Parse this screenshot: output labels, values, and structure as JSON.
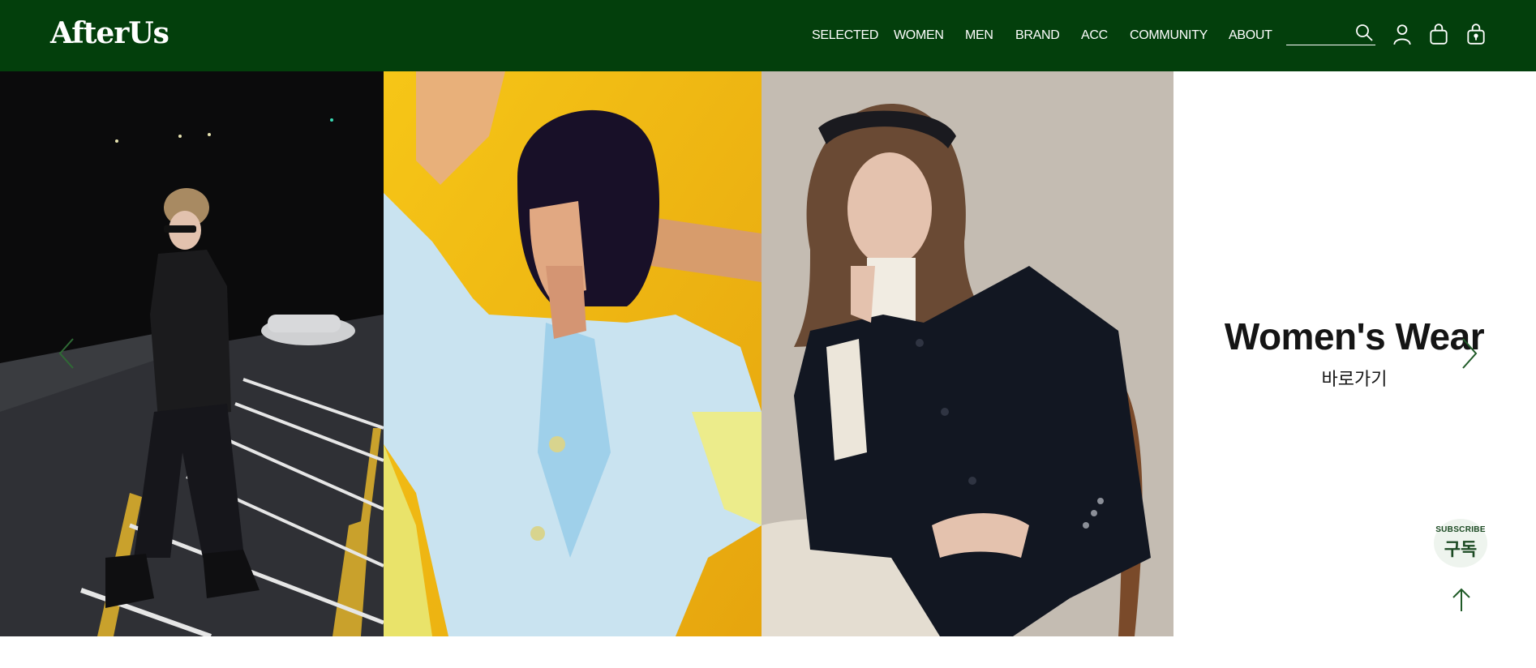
{
  "brand": {
    "logo_text": "AfterUs"
  },
  "nav": {
    "items": [
      {
        "label": "SELECTED"
      },
      {
        "label": "WOMEN"
      },
      {
        "label": "MEN"
      },
      {
        "label": "BRAND"
      },
      {
        "label": "ACC"
      },
      {
        "label": "COMMUNITY"
      },
      {
        "label": "ABOUT"
      }
    ]
  },
  "search": {
    "value": "",
    "placeholder": ""
  },
  "header_icons": [
    "search-icon",
    "user-icon",
    "shopping-bag-icon",
    "lock-bag-icon"
  ],
  "slider": {
    "images": [
      "woman-leather-jacket-night-street-photo",
      "woman-bob-hair-yellow-background-photo",
      "woman-navy-jacket-chair-photo"
    ],
    "title": "Women's Wear",
    "subtitle": "바로가기"
  },
  "subscribe": {
    "label_en": "SUBSCRIBE",
    "label_ko": "구독"
  },
  "colors": {
    "header_bg": "#033f0c",
    "accent_green": "#1c4a23",
    "text_dark": "#151515"
  }
}
